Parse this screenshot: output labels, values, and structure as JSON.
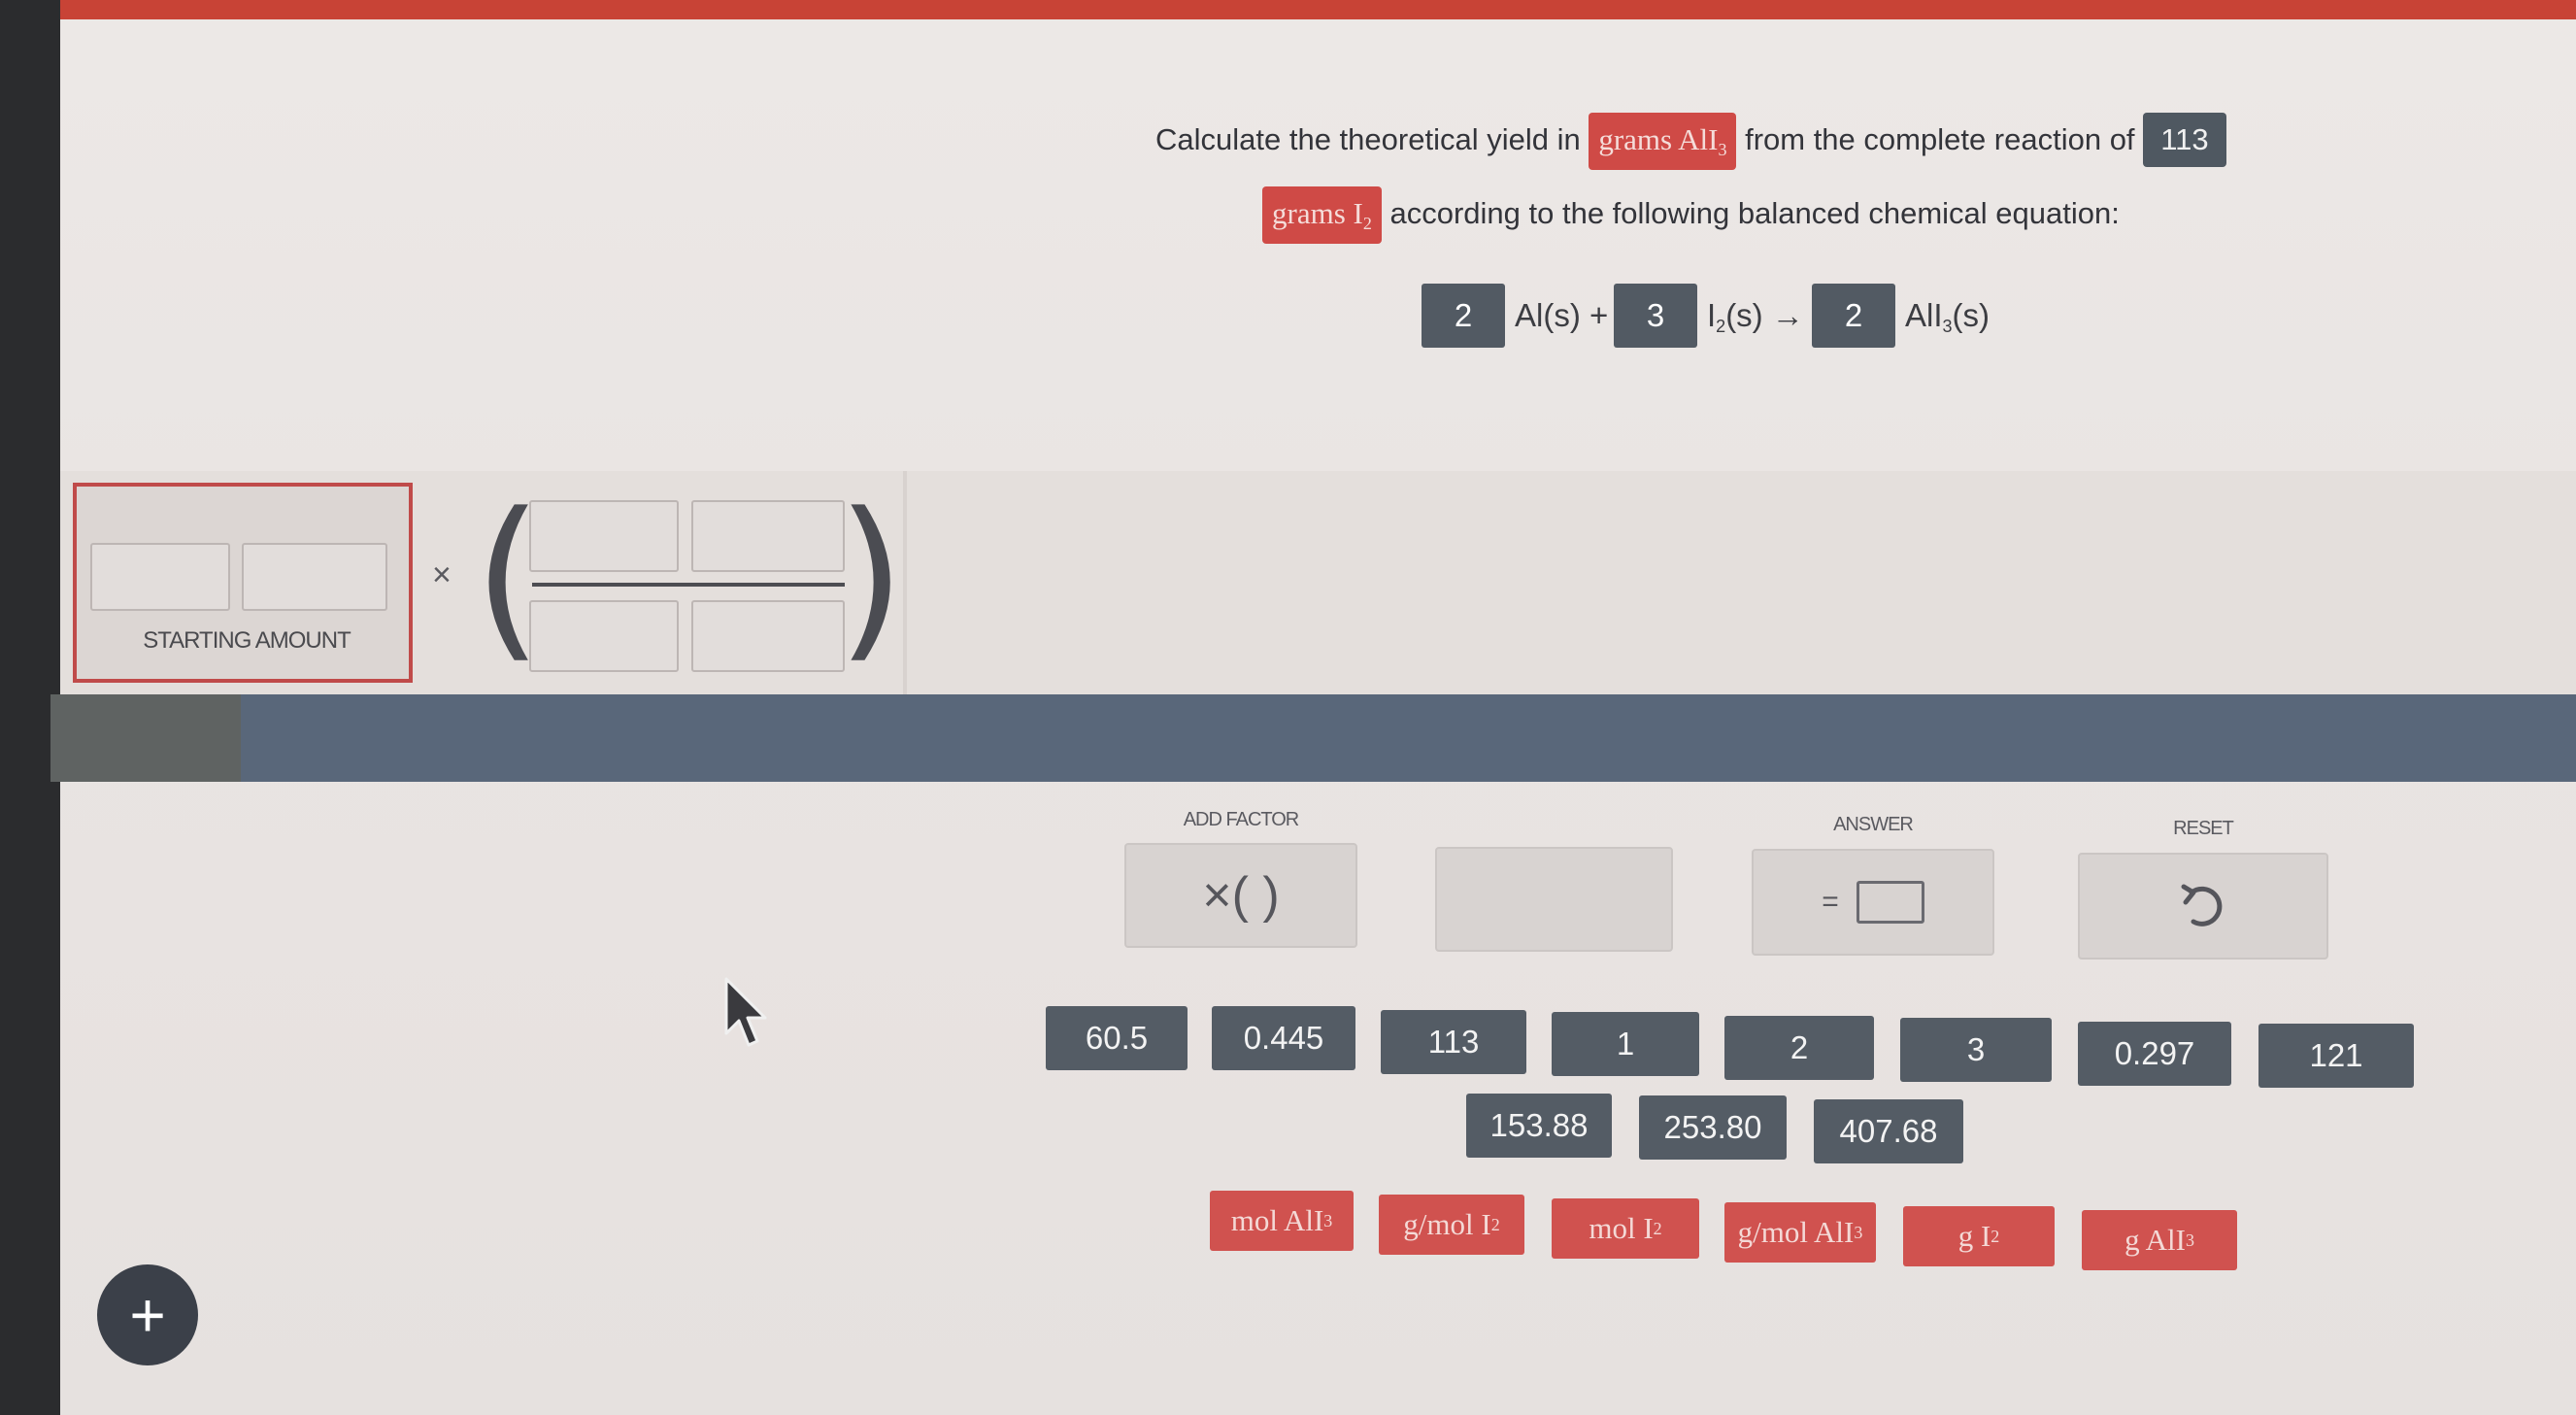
{
  "colors": {
    "accent_red": "#cf4a46",
    "button_dark": "#545c65",
    "band_blue": "#59677a"
  },
  "question": {
    "part1": "Calculate the theoretical yield in",
    "target_unit": "grams AlI",
    "target_sub": "3",
    "part2": "from the complete reaction of",
    "amount": "113",
    "start_unit": "grams I",
    "start_sub": "2",
    "part3": "according to the following balanced chemical equation:"
  },
  "equation": {
    "coef1": "2",
    "species1": "Al(s) +",
    "coef2": "3",
    "species2_main": "I",
    "species2_sub": "2",
    "species2_rest": "(s) →",
    "coef3": "2",
    "species3_main": "AlI",
    "species3_sub": "3",
    "species3_rest": "(s)"
  },
  "work": {
    "starting_amount_label": "STARTING AMOUNT",
    "times": "×"
  },
  "controls": {
    "add_factor_label": "ADD FACTOR",
    "add_factor_symbol": "×( )",
    "answer_label": "ANSWER",
    "answer_symbol": "=",
    "reset_label": "RESET",
    "reset_icon": "undo-arrow"
  },
  "numbers_row1": [
    "60.5",
    "0.445",
    "113",
    "1",
    "2",
    "3",
    "0.297",
    "121"
  ],
  "numbers_row2": [
    "153.88",
    "253.80",
    "407.68"
  ],
  "units": [
    {
      "main": "mol AlI",
      "sub": "3"
    },
    {
      "main": "g/mol I",
      "sub": "2"
    },
    {
      "main": "mol I",
      "sub": "2"
    },
    {
      "main": "g/mol AlI",
      "sub": "3"
    },
    {
      "main": "g I",
      "sub": "2"
    },
    {
      "main": "g AlI",
      "sub": "3"
    }
  ],
  "fab": {
    "symbol": "+"
  }
}
